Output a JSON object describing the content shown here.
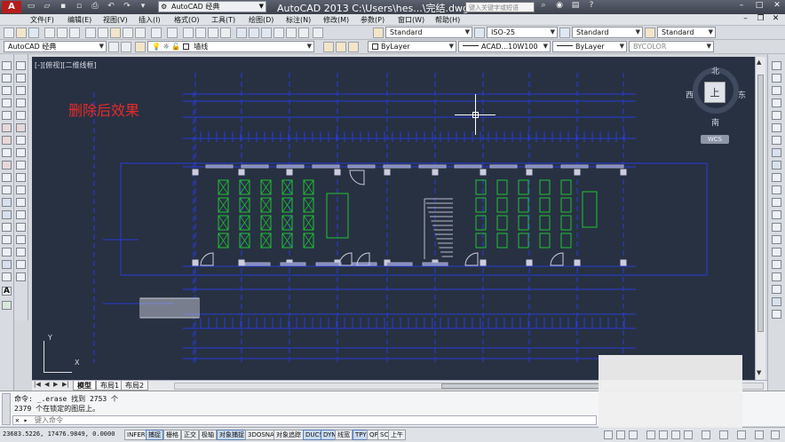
{
  "titlebar": {
    "app_logo": "A",
    "workspace": "AutoCAD 经典",
    "title": "AutoCAD 2013    C:\\Users\\hes...\\完结.dwg",
    "search_placeholder": "键入关键字或短语"
  },
  "menu": {
    "items": [
      "文件(F)",
      "编辑(E)",
      "视图(V)",
      "插入(I)",
      "格式(O)",
      "工具(T)",
      "绘图(D)",
      "标注(N)",
      "修改(M)",
      "参数(P)",
      "窗口(W)",
      "帮助(H)"
    ]
  },
  "toolbar2": {
    "workspace": "AutoCAD 经典",
    "layer": "墙线",
    "color": "ByLayer",
    "linetype": "ACAD...10W100",
    "lineweight": "ByLayer",
    "plotstyle": "BYCOLOR"
  },
  "toolbar1": {
    "text_style": "Standard",
    "dim_style": "ISO-25",
    "table_style": "Standard",
    "multileader_style": "Standard"
  },
  "canvas": {
    "viewport_label": "[-][俯视][二维线框]",
    "annotation": "删除后效果",
    "background": "#273142",
    "line_color": "#2b3bd8",
    "green_color": "#21c432",
    "viewcube": {
      "north": "北",
      "south": "南",
      "east": "东",
      "west": "西",
      "face": "上"
    },
    "wcs": "WCS",
    "ucs_x": "X",
    "ucs_y": "Y"
  },
  "tabs": {
    "items": [
      "模型",
      "布局1",
      "布局2"
    ],
    "active": "模型"
  },
  "command": {
    "line1": "命令:  _.erase 找到 2753 个",
    "line2": "2379 个在锁定的图层上。",
    "prompt_placeholder": "键入命令"
  },
  "status": {
    "coords": "23683.5226, 17476.9849, 0.0000",
    "buttons": [
      "INFER",
      "捕捉",
      "栅格",
      "正交",
      "极轴",
      "对象捕捉",
      "3DOSNAP",
      "对象追踪",
      "DUCS",
      "DYN",
      "线宽",
      "TPY",
      "QP",
      "SC",
      "上午"
    ]
  }
}
